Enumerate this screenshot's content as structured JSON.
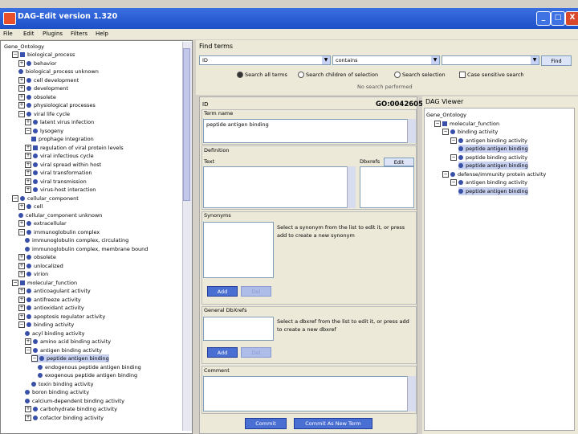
{
  "window": {
    "title": "DAG-Edit version 1.320",
    "minimize_label": "_",
    "maximize_label": "□",
    "close_label": "X"
  },
  "menu": [
    "File",
    "Edit",
    "Plugins",
    "Filters",
    "Help"
  ],
  "tree": {
    "root": "Gene_Ontology",
    "nodes": [
      {
        "label": "biological_process",
        "level": 1,
        "type": "p",
        "expander": "-"
      },
      {
        "label": "behavior",
        "level": 2,
        "type": "i",
        "expander": "+"
      },
      {
        "label": "biological_process unknown",
        "level": 2,
        "type": "i",
        "expander": ""
      },
      {
        "label": "cell development",
        "level": 2,
        "type": "i",
        "expander": "+"
      },
      {
        "label": "development",
        "level": 2,
        "type": "i",
        "expander": "+"
      },
      {
        "label": "obsolete",
        "level": 2,
        "type": "i",
        "expander": "+"
      },
      {
        "label": "physiological processes",
        "level": 2,
        "type": "i",
        "expander": "+"
      },
      {
        "label": "viral life cycle",
        "level": 2,
        "type": "i",
        "expander": "-"
      },
      {
        "label": "latent virus infection",
        "level": 3,
        "type": "i",
        "expander": "+"
      },
      {
        "label": "lysogeny",
        "level": 3,
        "type": "i",
        "expander": "-"
      },
      {
        "label": "prophage integration",
        "level": 4,
        "type": "p",
        "expander": ""
      },
      {
        "label": "regulation of viral protein levels",
        "level": 3,
        "type": "p",
        "expander": "+"
      },
      {
        "label": "viral infectious cycle",
        "level": 3,
        "type": "i",
        "expander": "+"
      },
      {
        "label": "viral spread within host",
        "level": 3,
        "type": "i",
        "expander": "+"
      },
      {
        "label": "viral transformation",
        "level": 3,
        "type": "i",
        "expander": "+"
      },
      {
        "label": "viral transmission",
        "level": 3,
        "type": "i",
        "expander": "+"
      },
      {
        "label": "virus-host interaction",
        "level": 3,
        "type": "i",
        "expander": "+"
      },
      {
        "label": "cellular_component",
        "level": 1,
        "type": "i",
        "expander": "-"
      },
      {
        "label": "cell",
        "level": 2,
        "type": "i",
        "expander": "+"
      },
      {
        "label": "cellular_component unknown",
        "level": 2,
        "type": "i",
        "expander": ""
      },
      {
        "label": "extracellular",
        "level": 2,
        "type": "i",
        "expander": "+"
      },
      {
        "label": "immunoglobulin complex",
        "level": 2,
        "type": "i",
        "expander": "-"
      },
      {
        "label": "immunoglobulin complex, circulating",
        "level": 3,
        "type": "i",
        "expander": ""
      },
      {
        "label": "immunoglobulin complex, membrane bound",
        "level": 3,
        "type": "i",
        "expander": ""
      },
      {
        "label": "obsolete",
        "level": 2,
        "type": "i",
        "expander": "+"
      },
      {
        "label": "unlocalized",
        "level": 2,
        "type": "i",
        "expander": "+"
      },
      {
        "label": "virion",
        "level": 2,
        "type": "i",
        "expander": "+"
      },
      {
        "label": "molecular_function",
        "level": 1,
        "type": "p",
        "expander": "-"
      },
      {
        "label": "anticoagulant activity",
        "level": 2,
        "type": "i",
        "expander": "+"
      },
      {
        "label": "antifreeze activity",
        "level": 2,
        "type": "i",
        "expander": "+"
      },
      {
        "label": "antioxidant activity",
        "level": 2,
        "type": "i",
        "expander": "+"
      },
      {
        "label": "apoptosis regulator activity",
        "level": 2,
        "type": "i",
        "expander": "+"
      },
      {
        "label": "binding activity",
        "level": 2,
        "type": "i",
        "expander": "-"
      },
      {
        "label": "acyl binding activity",
        "level": 3,
        "type": "i",
        "expander": ""
      },
      {
        "label": "amino acid binding activity",
        "level": 3,
        "type": "i",
        "expander": "+"
      },
      {
        "label": "antigen binding activity",
        "level": 3,
        "type": "i",
        "expander": "-"
      },
      {
        "label": "peptide antigen binding",
        "level": 4,
        "type": "i",
        "expander": "-",
        "selected": true
      },
      {
        "label": "endogenous peptide antigen binding",
        "level": 5,
        "type": "i",
        "expander": ""
      },
      {
        "label": "exogenous peptide antigen binding",
        "level": 5,
        "type": "i",
        "expander": ""
      },
      {
        "label": "toxin binding activity",
        "level": 4,
        "type": "i",
        "expander": ""
      },
      {
        "label": "boron binding activity",
        "level": 3,
        "type": "i",
        "expander": ""
      },
      {
        "label": "calcium-dependent binding activity",
        "level": 3,
        "type": "i",
        "expander": ""
      },
      {
        "label": "carbohydrate binding activity",
        "level": 3,
        "type": "i",
        "expander": "+"
      },
      {
        "label": "cofactor binding activity",
        "level": 3,
        "type": "i",
        "expander": "+"
      }
    ]
  },
  "find": {
    "heading": "Find terms",
    "field_value": "ID",
    "operator_value": "contains",
    "search_value": "",
    "find_button": "Find",
    "radio_search_all": "Search all terms",
    "radio_search_children": "Search children of selection",
    "radio_search_selection": "Search selection",
    "case_sensitive": "Case sensitive search",
    "no_search_performed": "No search performed"
  },
  "editor": {
    "id_label": "ID",
    "id_value": "GO:0042605",
    "term_name_label": "Term name",
    "term_name_value": "peptide antigen binding",
    "definition_label": "Definition",
    "text_label": "Text",
    "dbxrefs_label": "Dbxrefs",
    "edit_button": "Edit",
    "synonyms_label": "Synonyms",
    "synonyms_help": "Select a synonym from the list to edit it, or press add to create a new synonym",
    "add_button": "Add",
    "delete_button": "Del",
    "general_dbxrefs_label": "General DbXrefs",
    "general_help": "Select a dbxref from the list to edit it, or press add to create a new dbxref",
    "add_button2": "Add",
    "delete_button2": "Del",
    "comment_label": "Comment",
    "commit_button": "Commit",
    "commit_new_button": "Commit As New Term"
  },
  "dag": {
    "title": "DAG Viewer",
    "nodes": [
      {
        "label": "Gene_Ontology",
        "level": 0,
        "type": "",
        "expander": ""
      },
      {
        "label": "molecular_function",
        "level": 1,
        "type": "p",
        "expander": "-"
      },
      {
        "label": "binding activity",
        "level": 2,
        "type": "i",
        "expander": "-"
      },
      {
        "label": "antigen binding activity",
        "level": 3,
        "type": "i",
        "expander": "-"
      },
      {
        "label": "peptide antigen binding",
        "level": 4,
        "type": "i",
        "expander": "",
        "selected": true
      },
      {
        "label": "peptide binding activity",
        "level": 3,
        "type": "i",
        "expander": "-"
      },
      {
        "label": "peptide antigen binding",
        "level": 4,
        "type": "i",
        "expander": "",
        "selected": true
      },
      {
        "label": "defense/immunity protein activity",
        "level": 2,
        "type": "i",
        "expander": "-"
      },
      {
        "label": "antigen binding activity",
        "level": 3,
        "type": "i",
        "expander": "-"
      },
      {
        "label": "peptide antigen binding",
        "level": 4,
        "type": "i",
        "expander": "",
        "selected": true
      }
    ]
  }
}
